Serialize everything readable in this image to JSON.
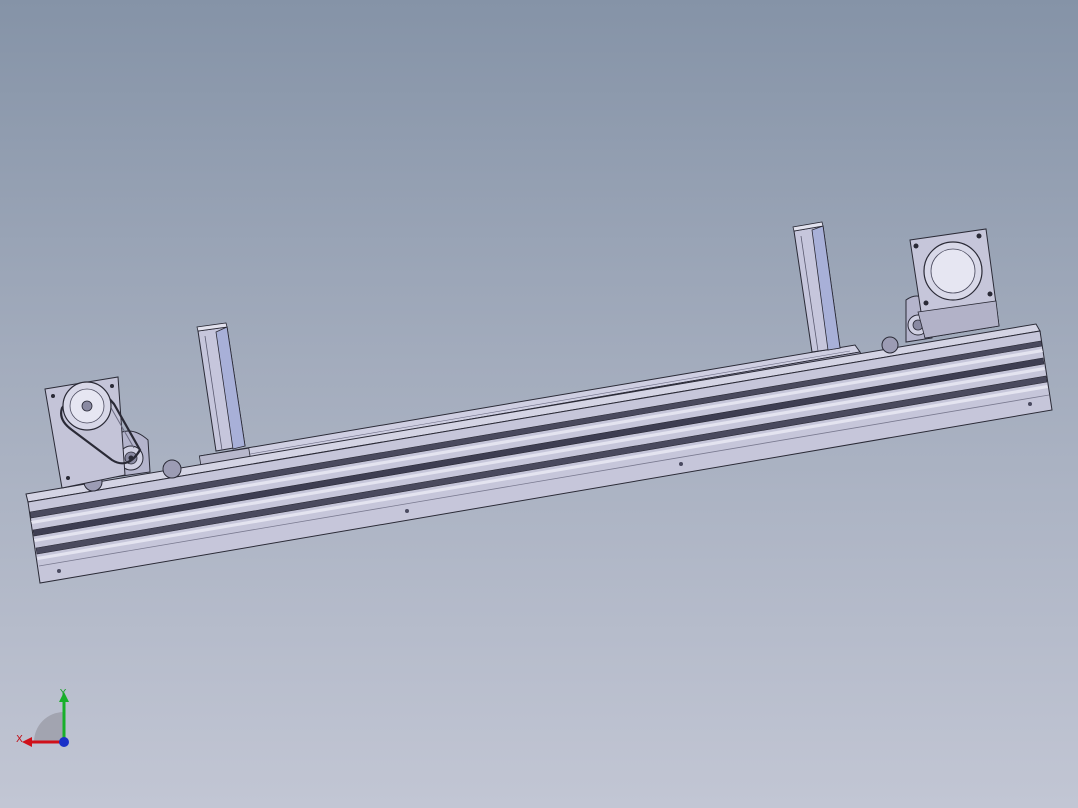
{
  "viewport": {
    "background_top": "#8593a7",
    "background_bottom": "#c2c6d4"
  },
  "model": {
    "parts": [
      "aluminium-extrusion-beam",
      "slide-carriage-plate",
      "left-vertical-post",
      "right-vertical-post",
      "left-servo-motor",
      "right-servo-motor",
      "left-belt-pulley-assembly",
      "right-belt-pulley-assembly"
    ],
    "colors": {
      "part_face": "#c8c8dc",
      "part_face_dark": "#a9a9c2",
      "edge": "#2a2a36",
      "highlight": "#e6e6f2"
    }
  },
  "triad": {
    "x_label": "X",
    "y_label": "Y",
    "colors": {
      "x": "#d0101a",
      "y": "#18b02a",
      "z": "#1a30c8"
    }
  }
}
